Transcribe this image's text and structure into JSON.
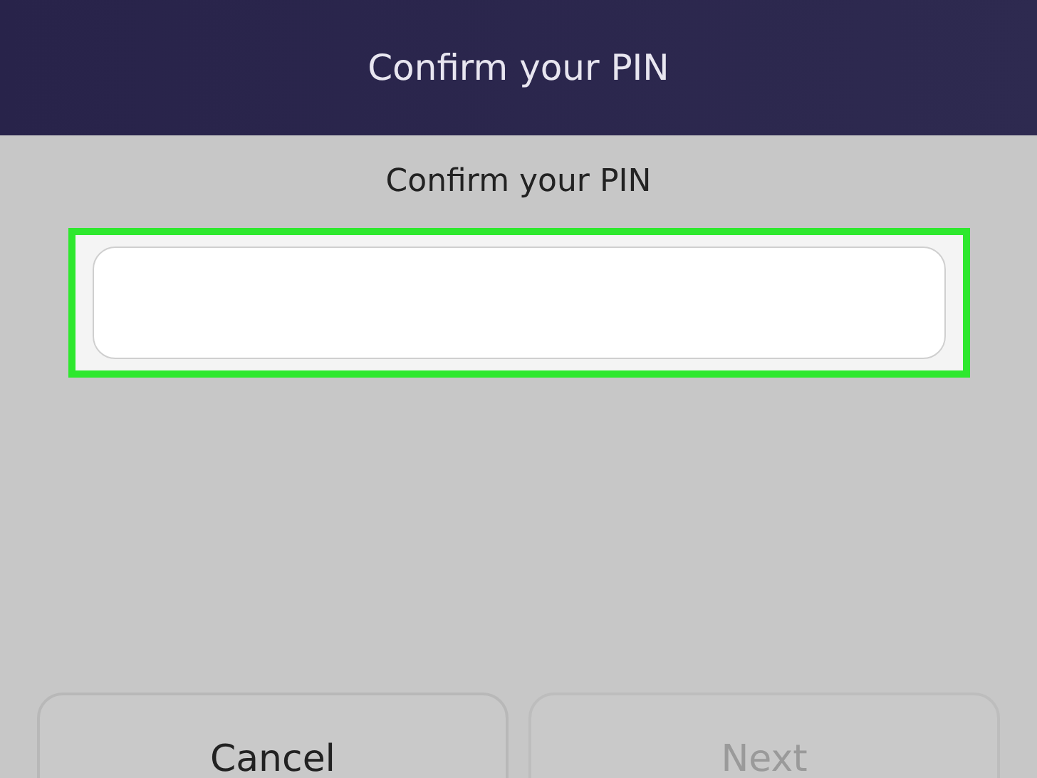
{
  "header": {
    "title": "Confirm your PIN"
  },
  "prompt": "Confirm your PIN",
  "pin_field": {
    "highlighted": true
  },
  "buttons": [
    {
      "label": "Cancel",
      "disabled": false
    },
    {
      "label": "Next",
      "disabled": true
    }
  ]
}
